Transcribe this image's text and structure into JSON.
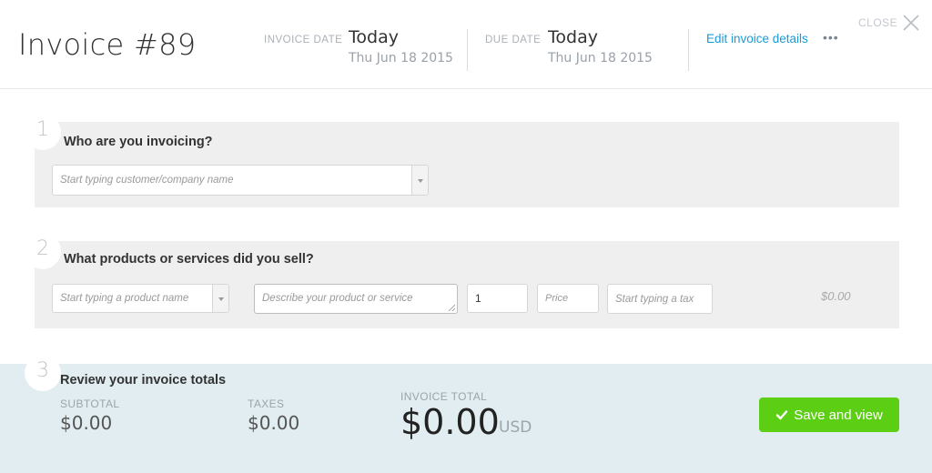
{
  "header": {
    "title": "Invoice #89",
    "invoice_date": {
      "label": "INVOICE DATE",
      "value": "Today",
      "date": "Thu Jun 18 2015"
    },
    "due_date": {
      "label": "DUE DATE",
      "value": "Today",
      "date": "Thu Jun 18 2015"
    },
    "edit_link": "Edit invoice details",
    "more_icon": "more-dots-icon",
    "close_label": "CLOSE",
    "close_icon": "close-icon"
  },
  "step1": {
    "number": "1",
    "title": "Who are you invoicing?",
    "customer_placeholder": "Start typing customer/company name"
  },
  "step2": {
    "number": "2",
    "title": "What products or services did you sell?",
    "product_placeholder": "Start typing a product name",
    "description_placeholder": "Describe your product or service",
    "quantity_value": "1",
    "price_placeholder": "Price",
    "tax_placeholder": "Start typing a tax",
    "line_amount": "$0.00"
  },
  "step3": {
    "number": "3",
    "title": "Review your invoice totals",
    "subtotal_label": "SUBTOTAL",
    "subtotal_value": "$0.00",
    "taxes_label": "TAXES",
    "taxes_value": "$0.00",
    "total_label": "INVOICE TOTAL",
    "total_value": "$0.00",
    "currency": "USD",
    "save_button": "Save and view"
  },
  "colors": {
    "accent_link": "#1a9bd7",
    "save_button": "#5ccf14",
    "totals_background": "#e1edf0",
    "section_background": "#efefef"
  }
}
